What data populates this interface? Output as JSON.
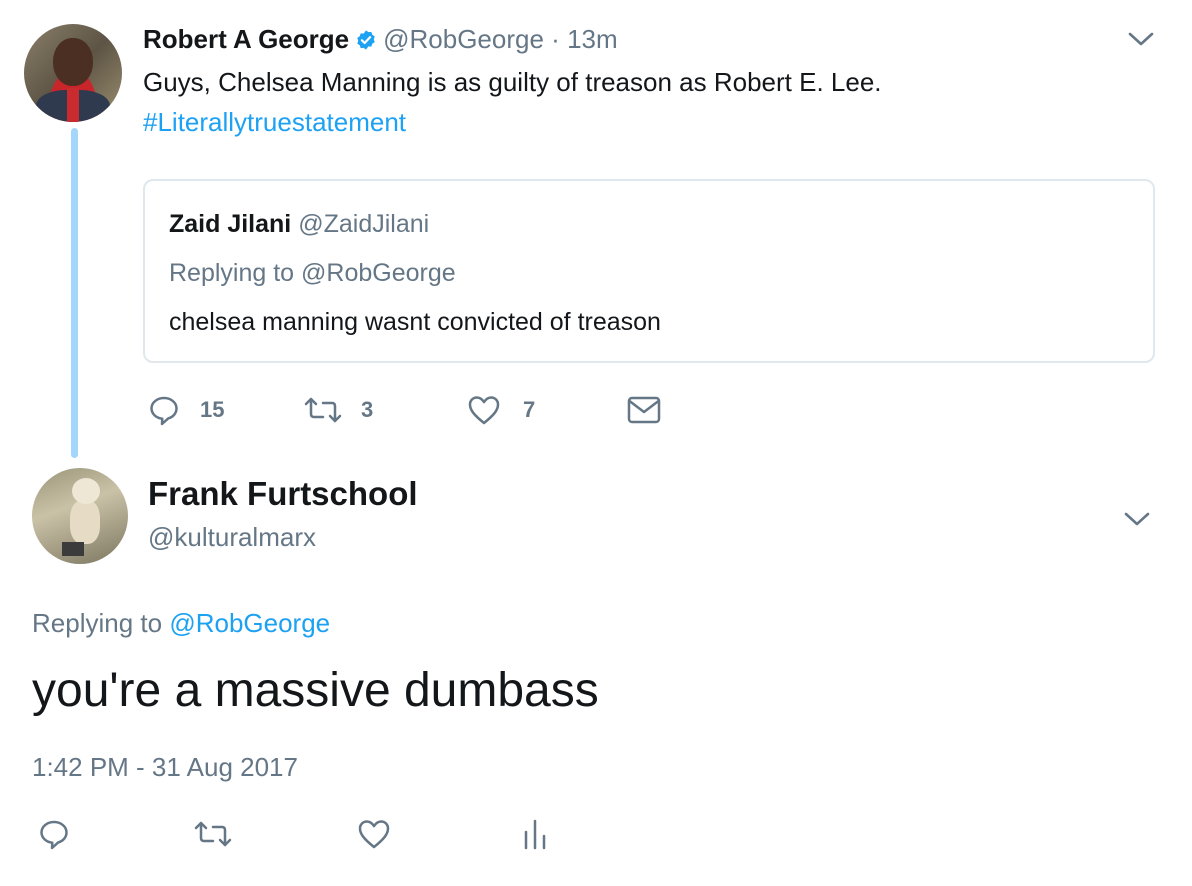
{
  "parent_tweet": {
    "display_name": "Robert A George",
    "handle": "@RobGeorge",
    "separator": "·",
    "time": "13m",
    "text": "Guys, Chelsea Manning is as guilty of treason as Robert E. Lee.",
    "hashtag": "#Literallytruestatement",
    "quoted_tweet": {
      "display_name": "Zaid Jilani",
      "handle": "@ZaidJilani",
      "replying_to": "Replying to @RobGeorge",
      "text": "chelsea manning wasnt convicted of treason"
    },
    "actions": {
      "reply_count": "15",
      "retweet_count": "3",
      "like_count": "7"
    },
    "icons": [
      "verified-badge-icon",
      "chevron-down-icon",
      "reply-icon",
      "retweet-icon",
      "like-icon",
      "direct-message-icon"
    ],
    "colors": {
      "verified": "#1da1f2",
      "hashtag": "#1da1f2",
      "thread_line": "#a3d6fb"
    }
  },
  "reply_tweet": {
    "display_name": "Frank Furtschool",
    "handle": "@kulturalmarx",
    "replying_to_prefix": "Replying to",
    "replying_to_mention": "@RobGeorge",
    "text": "you're a massive dumbass",
    "timestamp": "1:42 PM - 31 Aug 2017",
    "icons": [
      "chevron-down-icon",
      "reply-icon",
      "retweet-icon",
      "like-icon",
      "analytics-icon"
    ],
    "colors": {
      "mention": "#1da1f2",
      "muted": "#657786"
    }
  }
}
